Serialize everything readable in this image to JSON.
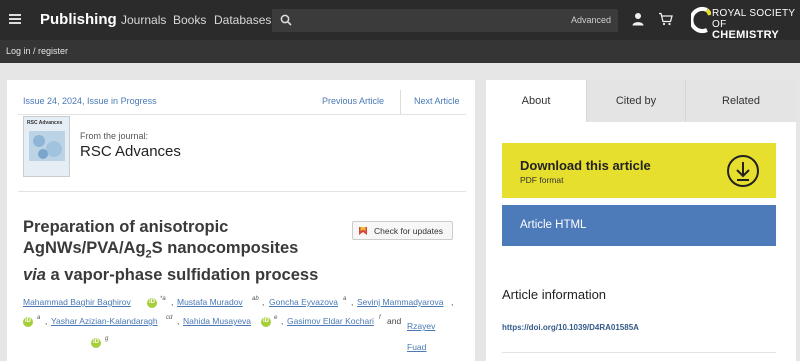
{
  "header": {
    "brand": "Publishing",
    "nav": [
      "Journals",
      "Books",
      "Databases"
    ],
    "search": {
      "placeholder": "",
      "advanced_label": "Advanced"
    },
    "logo": {
      "line1": "ROYAL SOCIETY",
      "line2_prefix": "OF ",
      "line2_bold": "CHEMISTRY"
    },
    "icons": [
      "menu-icon",
      "search-icon",
      "user-icon",
      "cart-icon"
    ]
  },
  "subbar": {
    "login_label": "Log in / register"
  },
  "article_nav": {
    "issue": "Issue 24, 2024, Issue in Progress",
    "prev": "Previous Article",
    "next": "Next Article"
  },
  "journal": {
    "from_label": "From the journal:",
    "name": "RSC Advances",
    "cover_title": "RSC Advances"
  },
  "article": {
    "title_line1": "Preparation of anisotropic",
    "title_line2_pre": "AgNWs/PVA/Ag",
    "title_line2_sub": "2",
    "title_line2_post": "S nanocomposites",
    "title_line3_italic": "via",
    "title_line3_rest": " a vapor-phase sulfidation process",
    "check_updates": "Check for updates",
    "authors": [
      {
        "name": "Mahammad Baghir Baghirov",
        "aff": "*a",
        "orcid": true
      },
      {
        "name": "Mustafa Muradov",
        "aff": "ab",
        "orcid": false
      },
      {
        "name": "Goncha Eyvazova",
        "aff": "a",
        "orcid": false
      },
      {
        "name": "Sevinj Mammadyarova",
        "aff": "",
        "orcid": false
      },
      {
        "name": "",
        "aff": "a",
        "orcid": true
      },
      {
        "name": "Yashar Azizian-Kalandaragh",
        "aff": "cd",
        "orcid": false
      },
      {
        "name": "Nahida Musayeva",
        "aff": "e",
        "orcid": true
      },
      {
        "name": "Gasimov Eldar Kochari",
        "aff": "f",
        "orcid": false
      },
      {
        "name": "Rzayev Fuad Huseynali",
        "aff": "g",
        "orcid": true
      }
    ],
    "and_label": "and",
    "comma": ","
  },
  "sidebar": {
    "tabs": [
      "About",
      "Cited by",
      "Related"
    ],
    "active_tab": "About",
    "download": {
      "title": "Download this article",
      "subtitle": "PDF format"
    },
    "html_label": "Article HTML",
    "info_heading": "Article information",
    "doi": "https://doi.org/10.1039/D4RA01585A"
  },
  "colors": {
    "topbar": "#2b2b2b",
    "link": "#4a79b5",
    "download_bg": "#e7df2e",
    "html_bg": "#4d7ab9",
    "orcid": "#a6ce39"
  }
}
